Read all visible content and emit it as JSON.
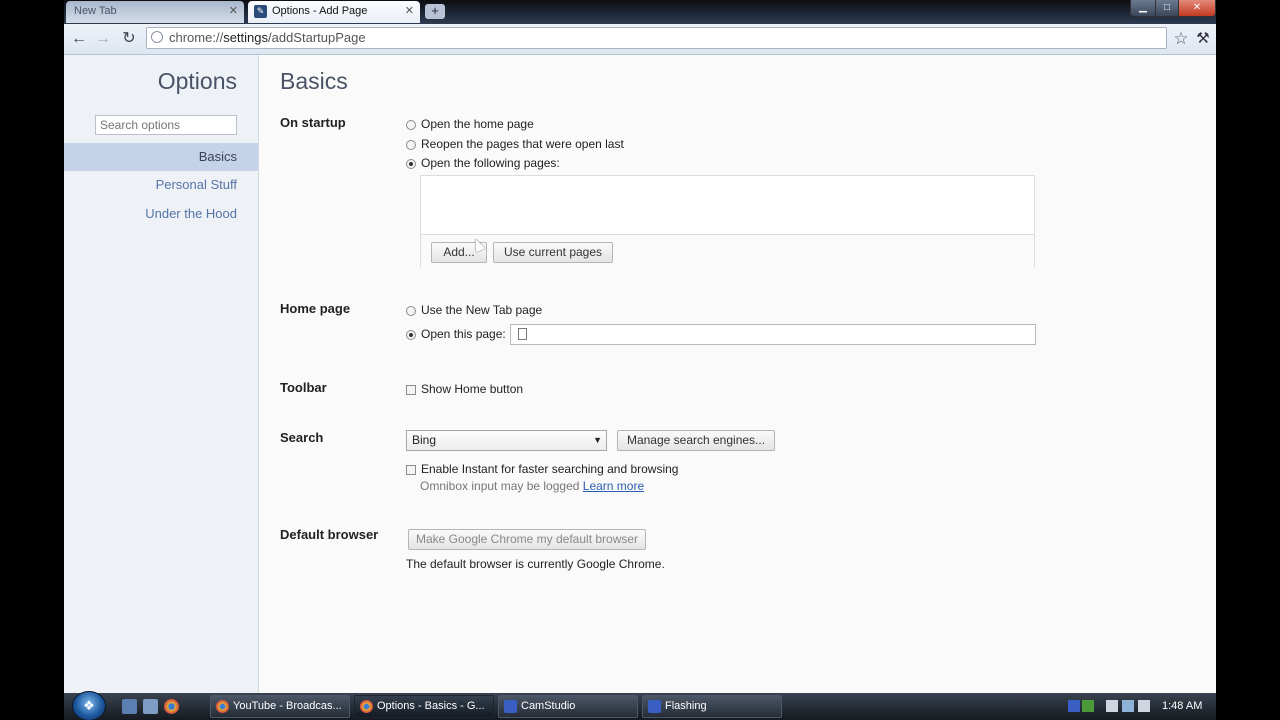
{
  "browser": {
    "tabs": [
      {
        "label": "New Tab",
        "active": false
      },
      {
        "label": "Options - Add Page",
        "active": true
      }
    ],
    "new_tab_label": "+",
    "url_prefix": "chrome://",
    "url_host": "settings",
    "url_path": "/addStartupPage",
    "window_controls": {
      "minimize": "▁",
      "maximize": "□",
      "close": "✕"
    }
  },
  "toolbar": {
    "back_icon": "←",
    "forward_icon": "→",
    "reload_icon": "↻",
    "star_icon": "☆",
    "wrench_icon": "🔧"
  },
  "sidebar": {
    "title": "Options",
    "search_placeholder": "Search options",
    "items": [
      {
        "label": "Basics",
        "selected": true
      },
      {
        "label": "Personal Stuff",
        "selected": false
      },
      {
        "label": "Under the Hood",
        "selected": false
      }
    ]
  },
  "main": {
    "heading": "Basics",
    "on_startup": {
      "label": "On startup",
      "options": [
        "Open the home page",
        "Reopen the pages that were open last",
        "Open the following pages:"
      ],
      "selected_index": 2,
      "add_button": "Add...",
      "use_current_button": "Use current pages"
    },
    "home_page": {
      "label": "Home page",
      "option_newtab": "Use the New Tab page",
      "option_open": "Open this page:",
      "url_value": ""
    },
    "toolbar_section": {
      "label": "Toolbar",
      "show_home": "Show Home button",
      "show_home_checked": false
    },
    "search": {
      "label": "Search",
      "engine": "Bing",
      "manage_button": "Manage search engines...",
      "instant": "Enable Instant for faster searching and browsing",
      "instant_checked": false,
      "hint": "Omnibox input may be logged",
      "learn_more": "Learn more"
    },
    "default_browser": {
      "label": "Default browser",
      "button": "Make Google Chrome my default browser",
      "status": "The default browser is currently Google Chrome."
    }
  },
  "taskbar": {
    "tasks": [
      {
        "label": "YouTube - Broadcas...",
        "icon_color": "#d94b3c"
      },
      {
        "label": "Options - Basics - G...",
        "icon_color": "#e1b23c",
        "active": true
      },
      {
        "label": "CamStudio",
        "icon_color": "#3a5fc4"
      },
      {
        "label": "Flashing",
        "icon_color": "#3a5fc4"
      }
    ],
    "clock": "1:48 AM"
  }
}
